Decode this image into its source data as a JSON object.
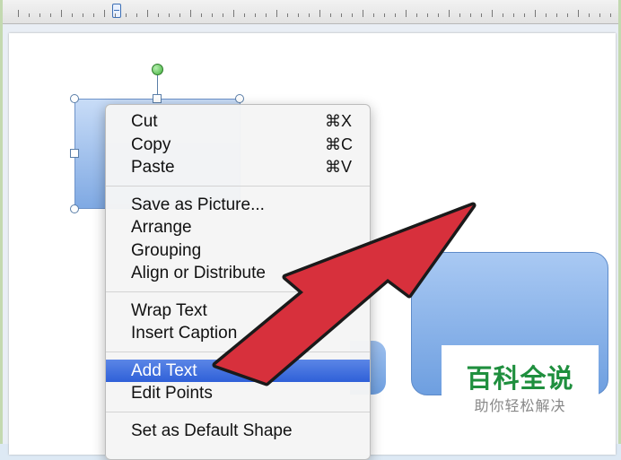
{
  "context_menu": {
    "groups": [
      [
        {
          "label": "Cut",
          "shortcut": "⌘X"
        },
        {
          "label": "Copy",
          "shortcut": "⌘C"
        },
        {
          "label": "Paste",
          "shortcut": "⌘V"
        }
      ],
      [
        {
          "label": "Save as Picture..."
        },
        {
          "label": "Arrange"
        },
        {
          "label": "Grouping"
        },
        {
          "label": "Align or Distribute"
        }
      ],
      [
        {
          "label": "Wrap Text"
        },
        {
          "label": "Insert Caption"
        }
      ],
      [
        {
          "label": "Add Text"
        },
        {
          "label": "Edit Points"
        }
      ],
      [
        {
          "label": "Set as Default Shape"
        }
      ]
    ],
    "highlighted": "Add Text"
  },
  "watermark": {
    "title": "百科全说",
    "subtitle": "助你轻松解决"
  },
  "colors": {
    "arrow_fill": "#d7303c",
    "highlight": "#3b6ee0",
    "shape_fill": "#8fb6ea",
    "rotation_handle": "#4cbb46",
    "watermark_green": "#1f8f3e"
  },
  "icons": {
    "ruler_marker": "ruler-indent-marker-icon",
    "rotation_handle": "rotate-handle-icon",
    "pointer": "red-arrow-icon"
  }
}
